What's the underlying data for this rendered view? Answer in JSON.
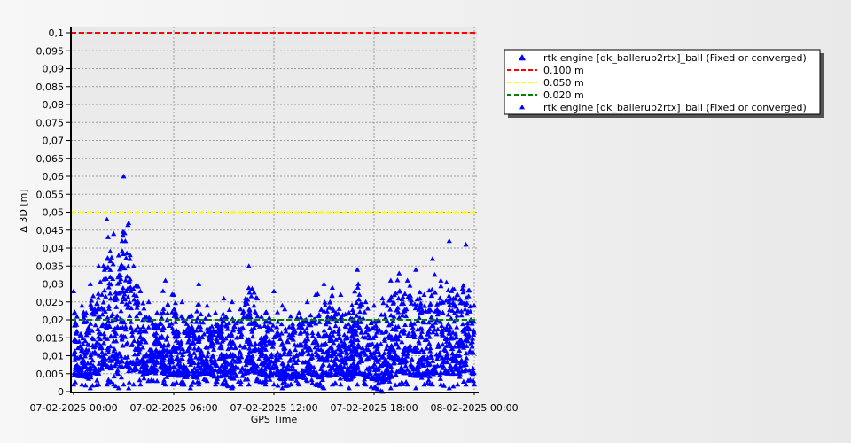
{
  "chart_data": {
    "type": "scatter",
    "title": "",
    "xlabel": "GPS Time",
    "ylabel": "Δ 3D [m]",
    "xlim": [
      "07-02-2025 00:00",
      "08-02-2025 00:00"
    ],
    "ylim": [
      0,
      0.1
    ],
    "x_ticks": [
      "07-02-2025 00:00",
      "07-02-2025 06:00",
      "07-02-2025 12:00",
      "07-02-2025 18:00",
      "08-02-2025 00:00"
    ],
    "y_ticks": [
      "0",
      "0,005",
      "0,01",
      "0,015",
      "0,02",
      "0,025",
      "0,03",
      "0,035",
      "0,04",
      "0,045",
      "0,05",
      "0,055",
      "0,06",
      "0,065",
      "0,07",
      "0,075",
      "0,08",
      "0,085",
      "0,09",
      "0,095",
      "0,1"
    ],
    "y_tick_values": [
      0,
      0.005,
      0.01,
      0.015,
      0.02,
      0.025,
      0.03,
      0.035,
      0.04,
      0.045,
      0.05,
      0.055,
      0.06,
      0.065,
      0.07,
      0.075,
      0.08,
      0.085,
      0.09,
      0.095,
      0.1
    ],
    "grid": true,
    "legend_position": "top-right",
    "thresholds": [
      {
        "name": "0.100 m",
        "value": 0.1,
        "color": "#ff0000"
      },
      {
        "name": "0.050 m",
        "value": 0.05,
        "color": "#ffff00"
      },
      {
        "name": "0.020 m",
        "value": 0.02,
        "color": "#008000"
      }
    ],
    "series": [
      {
        "name": "rtk engine [dk_ballerup2rtx]_ball (Fixed or converged)",
        "color": "#0000ff",
        "marker": "triangle",
        "x_hours": [
          0.0,
          0.5,
          1.0,
          1.5,
          2.0,
          2.4,
          2.7,
          3.0,
          3.3,
          3.6,
          4.0,
          4.5,
          5.0,
          5.5,
          6.0,
          6.5,
          7.0,
          7.5,
          8.0,
          8.5,
          9.0,
          9.5,
          10.0,
          10.5,
          11.0,
          11.5,
          12.0,
          12.5,
          13.0,
          13.5,
          14.0,
          14.5,
          15.0,
          15.5,
          16.0,
          16.5,
          17.0,
          17.5,
          18.0,
          18.5,
          19.0,
          19.5,
          20.0,
          20.5,
          21.0,
          21.5,
          22.0,
          22.5,
          23.0,
          23.5,
          24.0
        ],
        "peak_values": [
          0.028,
          0.024,
          0.03,
          0.035,
          0.048,
          0.044,
          0.038,
          0.06,
          0.047,
          0.035,
          0.028,
          0.025,
          0.022,
          0.031,
          0.027,
          0.025,
          0.021,
          0.03,
          0.024,
          0.022,
          0.026,
          0.025,
          0.023,
          0.035,
          0.026,
          0.022,
          0.028,
          0.024,
          0.021,
          0.022,
          0.025,
          0.027,
          0.03,
          0.029,
          0.027,
          0.022,
          0.034,
          0.025,
          0.024,
          0.026,
          0.031,
          0.033,
          0.031,
          0.034,
          0.027,
          0.037,
          0.031,
          0.042,
          0.027,
          0.041,
          0.024
        ],
        "low_values": [
          0.002,
          0.002,
          0.001,
          0.002,
          0.002,
          0.002,
          0.001,
          0.002,
          0.001,
          0.002,
          0.002,
          0.003,
          0.003,
          0.002,
          0.002,
          0.002,
          0.001,
          0.002,
          0.003,
          0.002,
          0.002,
          0.001,
          0.002,
          0.002,
          0.003,
          0.002,
          0.002,
          0.001,
          0.002,
          0.002,
          0.003,
          0.002,
          0.001,
          0.002,
          0.002,
          0.001,
          0.002,
          0.002,
          0.001,
          0.0,
          0.001,
          0.002,
          0.002,
          0.001,
          0.002,
          0.002,
          0.002,
          0.001,
          0.002,
          0.002,
          0.002
        ]
      }
    ]
  },
  "legend_items": [
    {
      "label": "rtk engine [dk_ballerup2rtx]_ball (Fixed or converged)",
      "kind": "marker-big",
      "color": "#0000ff"
    },
    {
      "label": "0.100 m",
      "kind": "dash",
      "color": "#ff0000"
    },
    {
      "label": "0.050 m",
      "kind": "dash",
      "color": "#ffff00"
    },
    {
      "label": "0.020 m",
      "kind": "dash",
      "color": "#008000"
    },
    {
      "label": "rtk engine [dk_ballerup2rtx]_ball (Fixed or converged)",
      "kind": "marker-small",
      "color": "#0000ff"
    }
  ]
}
